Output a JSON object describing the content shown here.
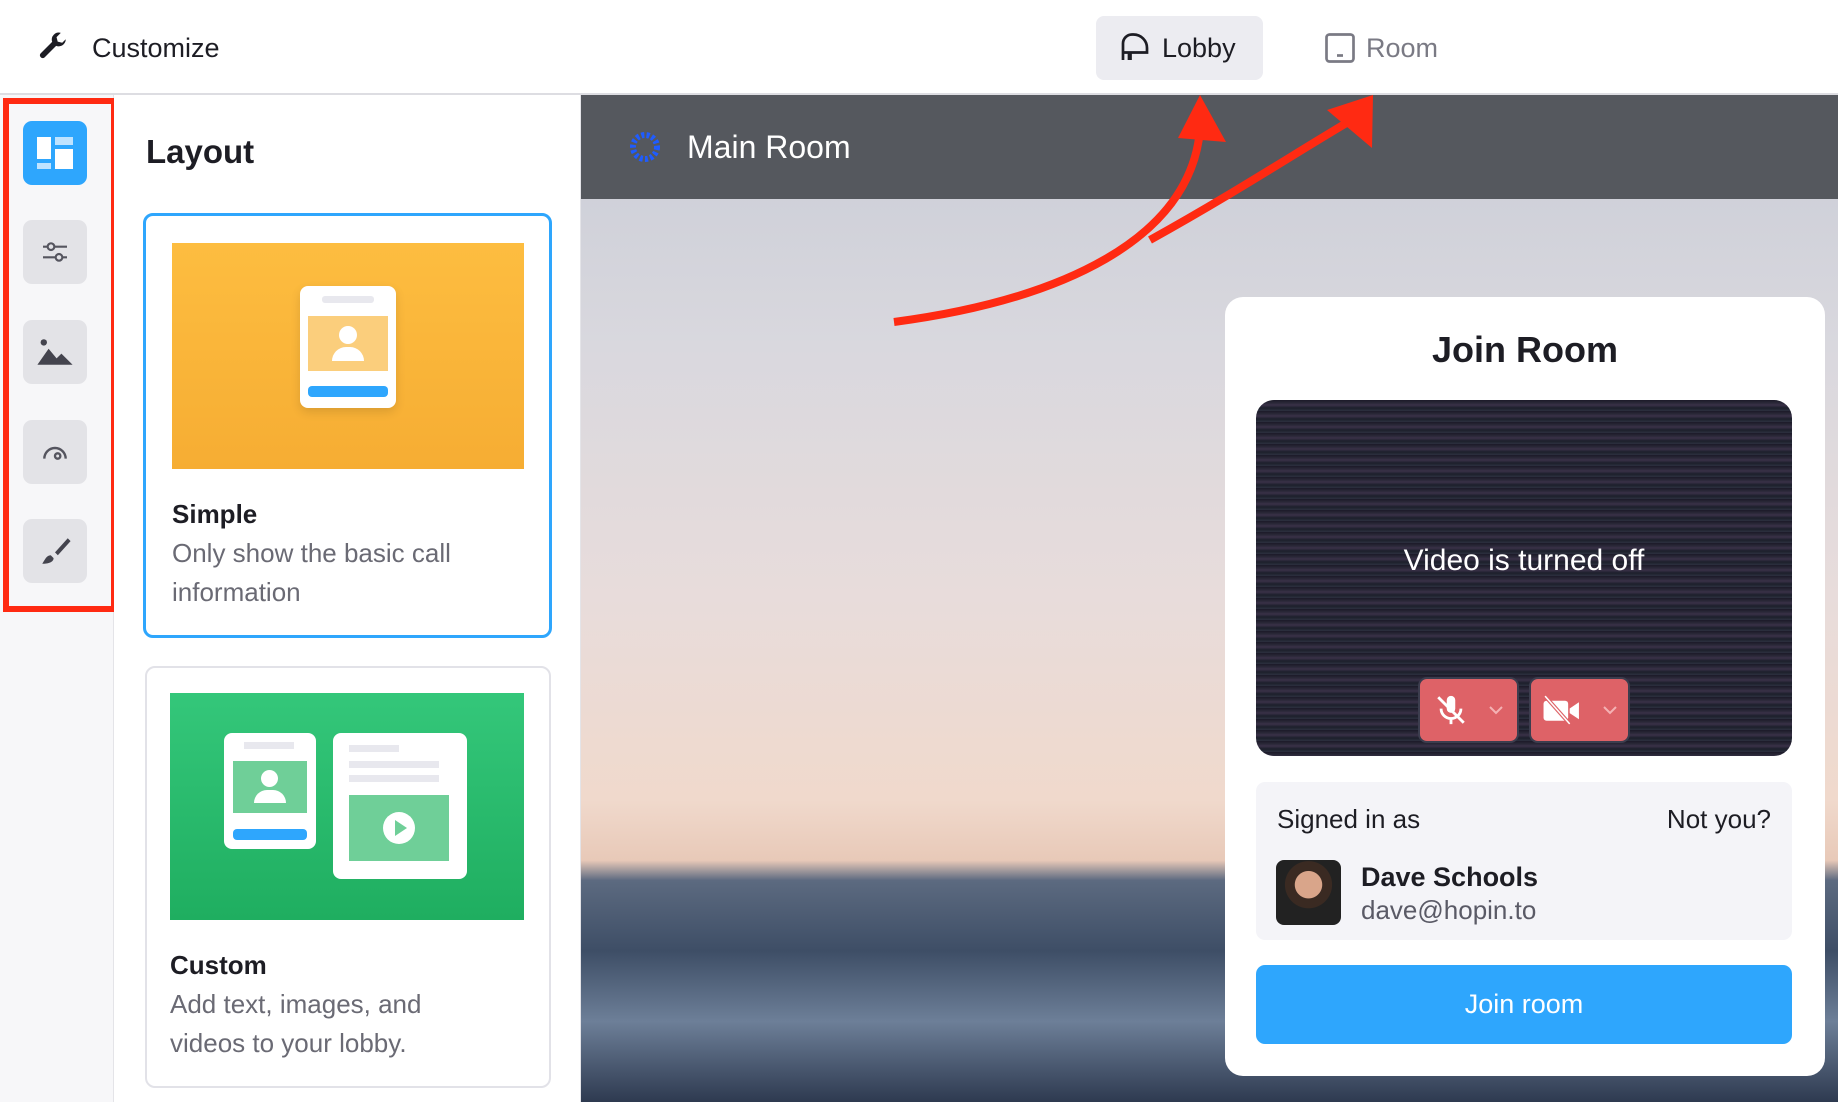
{
  "header": {
    "title": "Customize",
    "icon": "wrench-icon",
    "tabs": [
      {
        "label": "Lobby",
        "icon": "lobby-icon",
        "active": true
      },
      {
        "label": "Room",
        "icon": "room-icon",
        "active": false
      }
    ]
  },
  "rail": {
    "items": [
      {
        "name": "layout",
        "icon": "layout-icon",
        "active": true
      },
      {
        "name": "settings",
        "icon": "sliders-icon"
      },
      {
        "name": "background",
        "icon": "image-icon"
      },
      {
        "name": "speed",
        "icon": "gauge-icon"
      },
      {
        "name": "style",
        "icon": "brush-icon"
      }
    ]
  },
  "panel": {
    "title": "Layout",
    "cards": [
      {
        "title": "Simple",
        "desc_lines": [
          "Only show the basic call",
          "information"
        ],
        "selected": true
      },
      {
        "title": "Custom",
        "desc_lines": [
          "Add text, images, and",
          "videos to your lobby."
        ],
        "selected": false
      }
    ]
  },
  "preview": {
    "room_name": "Main Room",
    "join": {
      "title": "Join Room",
      "video_status": "Video is turned off",
      "signed_in_label": "Signed in as",
      "not_you": "Not you?",
      "user_name": "Dave Schools",
      "user_email": "dave@hopin.to",
      "join_button": "Join room"
    }
  },
  "colors": {
    "accent": "#2ea6fd",
    "annotation": "#ff2a12",
    "muted_control": "#de6267",
    "simple_card": "#fbb63a",
    "custom_card": "#2dbd6e"
  }
}
